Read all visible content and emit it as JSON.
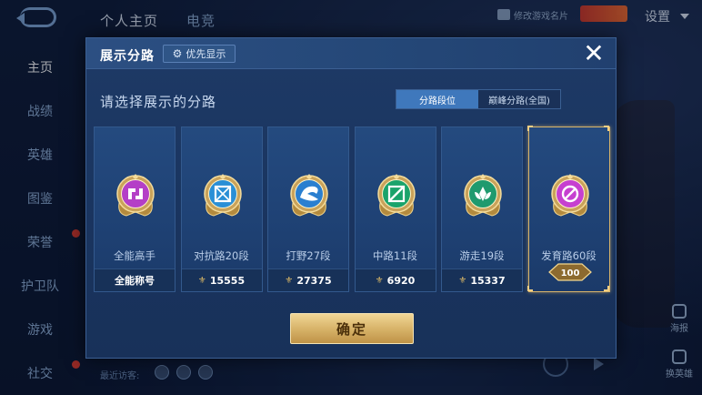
{
  "background": {
    "top_tabs": [
      "个人主页",
      "电竞"
    ],
    "profile_card_label": "修改游戏名片",
    "badge_label": "",
    "settings_label": "设置",
    "nav_items": [
      {
        "label": "主页",
        "active": true,
        "dot": false
      },
      {
        "label": "战绩",
        "active": false,
        "dot": false
      },
      {
        "label": "英雄",
        "active": false,
        "dot": false
      },
      {
        "label": "图鉴",
        "active": false,
        "dot": false
      },
      {
        "label": "荣誉",
        "active": false,
        "dot": true
      },
      {
        "label": "护卫队",
        "active": false,
        "dot": false
      },
      {
        "label": "游戏",
        "active": false,
        "dot": false
      },
      {
        "label": "社交",
        "active": false,
        "dot": true
      }
    ],
    "recent_visitors_label": "最近访客:",
    "right_items": [
      "海报",
      "换英雄"
    ]
  },
  "modal": {
    "title": "展示分路",
    "priority_label": "优先显示",
    "close_label": "✕",
    "subtitle": "请选择展示的分路",
    "toggle": [
      "分路段位",
      "巅峰分路(全国)"
    ],
    "confirm_label": "确定",
    "cards": [
      {
        "name": "全能高手",
        "value": "全能称号",
        "has_wing": false,
        "selected": false,
        "color": "#b43fc7",
        "glyph": "swirl"
      },
      {
        "name": "对抗路20段",
        "value": "15555",
        "has_wing": true,
        "selected": false,
        "color": "#2a8fd6",
        "glyph": "grid"
      },
      {
        "name": "打野27段",
        "value": "27375",
        "has_wing": true,
        "selected": false,
        "color": "#2a7fd0",
        "glyph": "dragon"
      },
      {
        "name": "中路11段",
        "value": "6920",
        "has_wing": true,
        "selected": false,
        "color": "#1aa36b",
        "glyph": "slash"
      },
      {
        "name": "游走19段",
        "value": "15337",
        "has_wing": true,
        "selected": false,
        "color": "#1f9a6e",
        "glyph": "leaf"
      },
      {
        "name": "发育路60段",
        "value": "",
        "has_wing": false,
        "selected": true,
        "color": "#c63fd0",
        "glyph": "ban",
        "level_badge": "100"
      }
    ]
  },
  "colors": {
    "accent_blue": "#3f78bc",
    "gold": "#d8b46a",
    "panel": "#1e3a66"
  }
}
